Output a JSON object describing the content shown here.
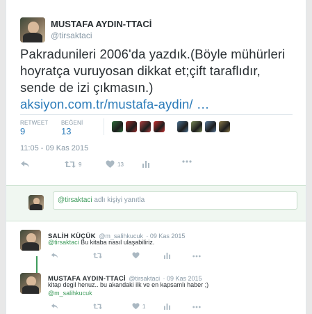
{
  "main_tweet": {
    "author_name": "MUSTAFA AYDIN-TTACİ",
    "author_handle": "@tirsaktaci",
    "text": "Pakradunileri 2006'da yazdık.(Böyle mühürleri hoyratça vuruyosan dikkat et;çift taraflıdır, sende de izi çıkmasın.)",
    "link": "aksiyon.com.tr/mustafa-aydin/ …",
    "retweet_label": "RETWEET",
    "retweet_count": "9",
    "like_label": "BEĞENİ",
    "like_count": "13",
    "timestamp": "11:05 - 09 Kas 2015",
    "action_retweet_count": "9",
    "action_like_count": "13",
    "liker_colors": [
      "#2e6b3a",
      "#9b2b2b",
      "#b04040",
      "#c73030",
      "#4a7090",
      "#7a8a5a",
      "#5a7a9a",
      "#8a7a4a"
    ]
  },
  "reply_box": {
    "mention": "@tirsaktaci",
    "placeholder": " adlı kişiyi yanıtla"
  },
  "replies": [
    {
      "author_name": "SALİH KÜÇÜK",
      "author_handle": "@m_salihkucuk",
      "date": "· 09 Kas 2015",
      "mention": "@tirsaktaci",
      "text": " Bu kitaba nasıl ulaşabiliriz."
    },
    {
      "author_name": "MUSTAFA AYDIN-TTACİ",
      "author_handle": "@tirsaktaci",
      "date": "· 09 Kas 2015",
      "text": "kitap degil henuz.. bu akandaki ilk ve en kapsamlı haber ;)",
      "mention": "@m_salihkucuk",
      "like_count": "1"
    }
  ]
}
